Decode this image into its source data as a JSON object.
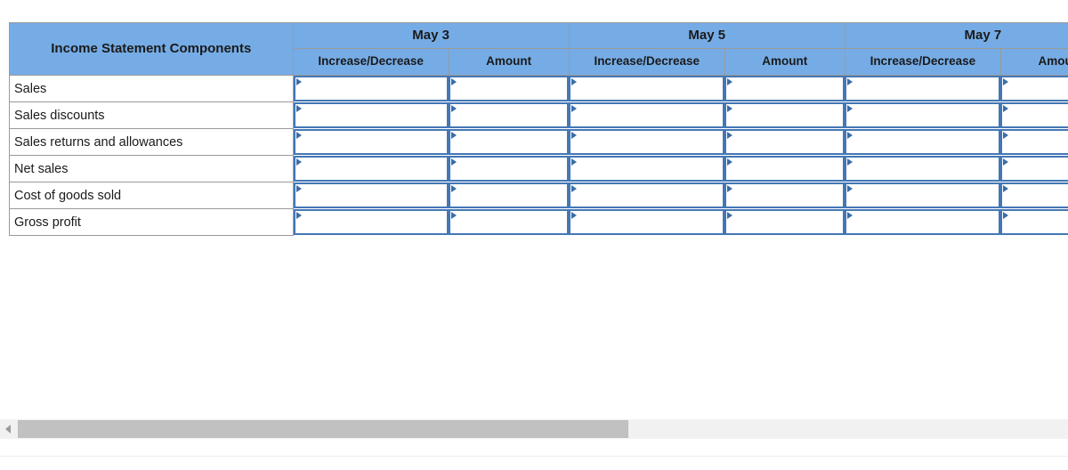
{
  "table": {
    "row_header_label": "Income Statement Components",
    "date_groups": [
      {
        "date": "May 3",
        "sub_columns": [
          "Increase/Decrease",
          "Amount"
        ]
      },
      {
        "date": "May 5",
        "sub_columns": [
          "Increase/Decrease",
          "Amount"
        ]
      },
      {
        "date": "May 7",
        "sub_columns": [
          "Increase/Decrease",
          "Amount"
        ]
      }
    ],
    "rows": [
      {
        "label": "Sales",
        "cells": [
          {
            "increase_decrease": "",
            "amount": ""
          },
          {
            "increase_decrease": "",
            "amount": ""
          },
          {
            "increase_decrease": "",
            "amount": ""
          }
        ]
      },
      {
        "label": "Sales discounts",
        "cells": [
          {
            "increase_decrease": "",
            "amount": ""
          },
          {
            "increase_decrease": "",
            "amount": ""
          },
          {
            "increase_decrease": "",
            "amount": ""
          }
        ]
      },
      {
        "label": "Sales returns and allowances",
        "cells": [
          {
            "increase_decrease": "",
            "amount": ""
          },
          {
            "increase_decrease": "",
            "amount": ""
          },
          {
            "increase_decrease": "",
            "amount": ""
          }
        ]
      },
      {
        "label": "Net sales",
        "cells": [
          {
            "increase_decrease": "",
            "amount": ""
          },
          {
            "increase_decrease": "",
            "amount": ""
          },
          {
            "increase_decrease": "",
            "amount": ""
          }
        ]
      },
      {
        "label": "Cost of goods sold",
        "cells": [
          {
            "increase_decrease": "",
            "amount": ""
          },
          {
            "increase_decrease": "",
            "amount": ""
          },
          {
            "increase_decrease": "",
            "amount": ""
          }
        ]
      },
      {
        "label": "Gross profit",
        "cells": [
          {
            "increase_decrease": "",
            "amount": ""
          },
          {
            "increase_decrease": "",
            "amount": ""
          },
          {
            "increase_decrease": "",
            "amount": ""
          }
        ]
      }
    ]
  },
  "scrollbar": {
    "left_arrow_icon": "triangle-left-icon",
    "thumb_fraction_percent": 58
  },
  "colors": {
    "header_blue": "#76ACE6",
    "input_border_blue": "#4477B5",
    "marker_blue": "#3A6DA8",
    "grid_gray": "#9A9A9A",
    "scroll_track": "#F1F1F1",
    "scroll_thumb": "#C1C1C1"
  }
}
